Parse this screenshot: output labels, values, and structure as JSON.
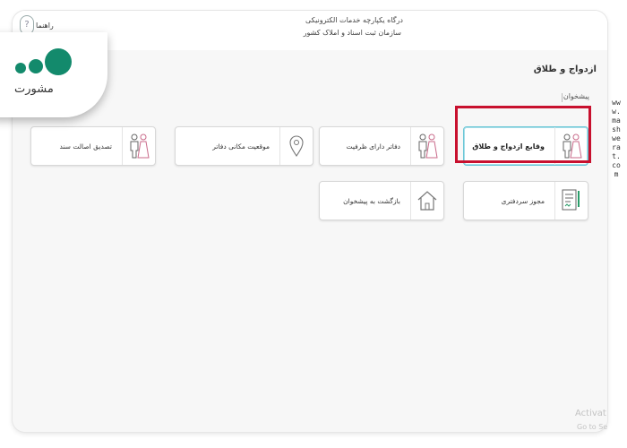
{
  "header": {
    "portal_line1": "درگاه یکپارچه خدمات الکترونیکی",
    "portal_line2": "سازمان ثبت اسناد و املاک کشور",
    "help_label": "راهنما"
  },
  "page": {
    "heading": "ازدواج و طلاق",
    "breadcrumb": "پیشخوان"
  },
  "cards": {
    "marriage_events": "وقایع ازدواج و طلاق",
    "capacity_offices": "دفاتر دارای ظرفیت",
    "office_location": "موقعیت مکانی دفاتر",
    "document_auth": "تصدیق اصالت سند",
    "notary_license": "مجوز سردفتری",
    "back_to_dashboard": "بازگشت به پیشخوان"
  },
  "branding": {
    "logo_text": "مشورت",
    "website": "www.mashwerat.com",
    "logo_color": "#138a6c",
    "highlight_color": "#c8102e"
  },
  "watermark": {
    "line1": "Activat",
    "line2": "Go to Se"
  }
}
